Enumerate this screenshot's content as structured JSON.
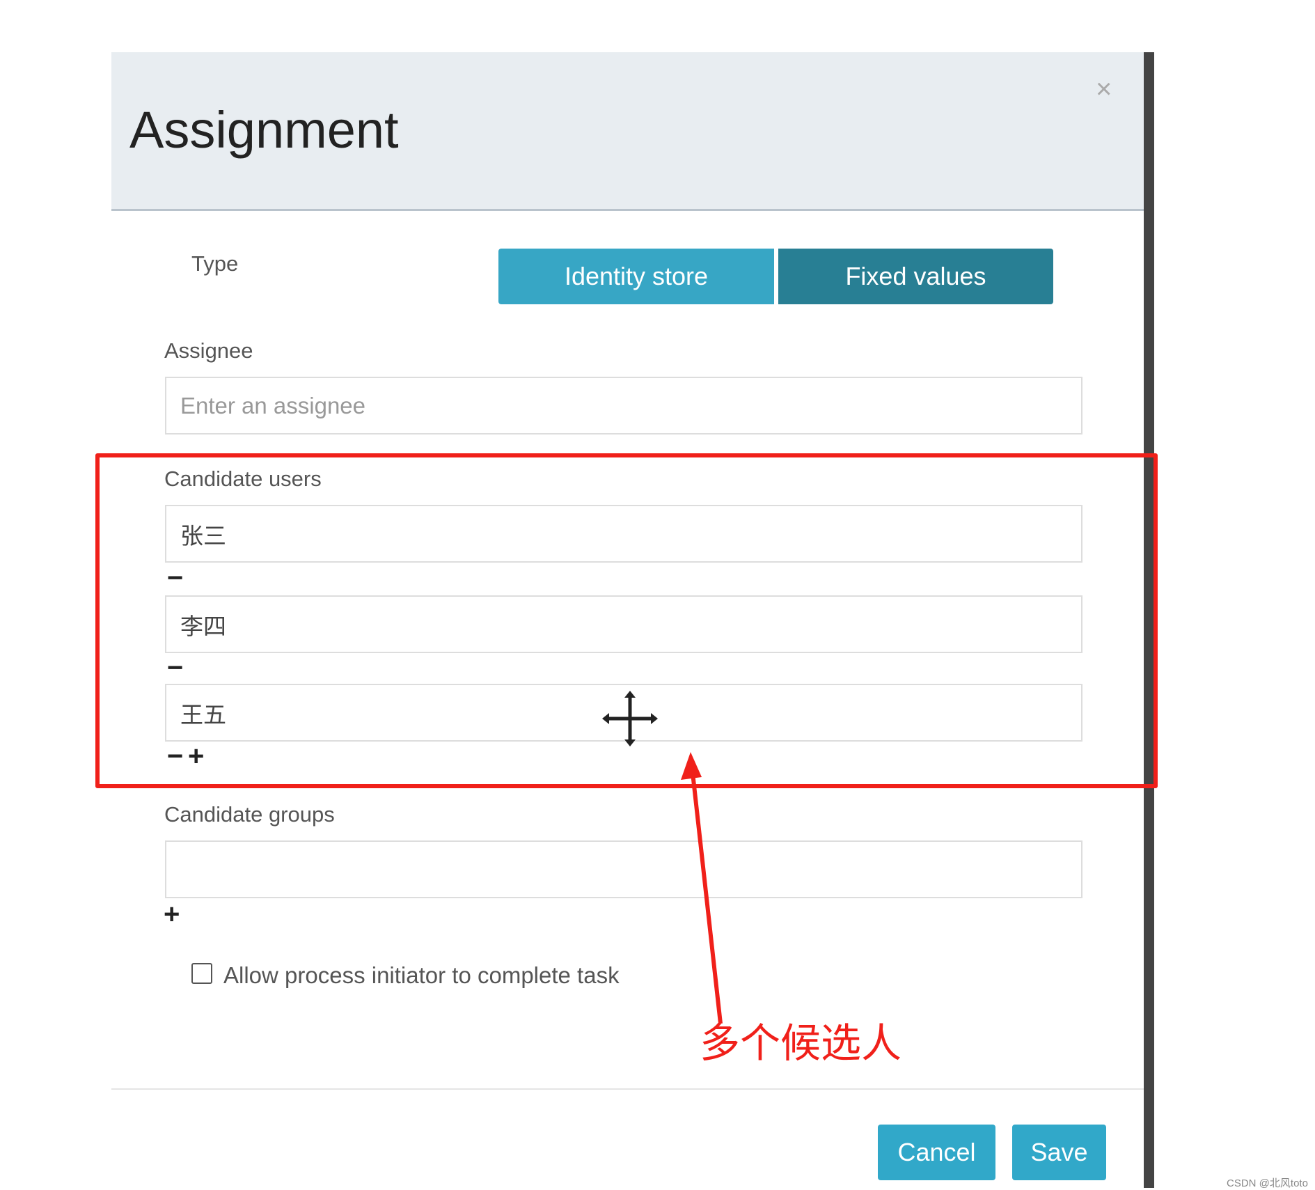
{
  "dialog": {
    "title": "Assignment",
    "close_icon": "close-icon"
  },
  "type": {
    "label": "Type",
    "options": [
      "Identity store",
      "Fixed values"
    ],
    "selected": "Fixed values"
  },
  "assignee": {
    "label": "Assignee",
    "placeholder": "Enter an assignee",
    "value": ""
  },
  "candidate_users": {
    "label": "Candidate users",
    "values": [
      "张三",
      "李四",
      "王五"
    ]
  },
  "candidate_groups": {
    "label": "Candidate groups",
    "values": [
      ""
    ]
  },
  "controls": {
    "remove": "−",
    "add": "+"
  },
  "allow_initiator": {
    "label": "Allow process initiator to complete task",
    "checked": false
  },
  "footer": {
    "cancel": "Cancel",
    "save": "Save"
  },
  "annotation": {
    "text": "多个候选人",
    "color": "#f0201a"
  },
  "watermark": "CSDN @北风toto",
  "colors": {
    "identity_button": "#37a6c5",
    "fixed_button": "#287f94",
    "footer_button": "#31a8c9"
  }
}
